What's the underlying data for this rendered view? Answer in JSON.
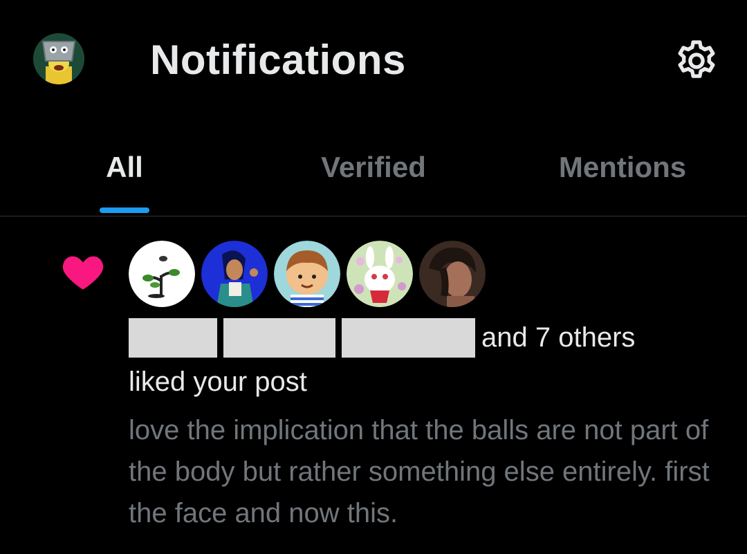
{
  "header": {
    "title": "Notifications",
    "profile_icon": "user-avatar",
    "settings_icon": "gear-icon"
  },
  "tabs": [
    {
      "label": "All",
      "active": true
    },
    {
      "label": "Verified",
      "active": false
    },
    {
      "label": "Mentions",
      "active": false
    }
  ],
  "notification": {
    "type": "like",
    "icon": "heart-icon",
    "icon_color": "#f91880",
    "avatar_count": 5,
    "others_text": "and 7 others",
    "action_text": "liked your post",
    "post_snippet": "love the implication that the balls are not part of the body but rather something else entirely. first the face and now this."
  },
  "colors": {
    "background": "#000000",
    "primary_text": "#e7e9ea",
    "secondary_text": "#71767b",
    "accent": "#1d9bf0",
    "like": "#f91880",
    "redaction": "#d9d9d9"
  }
}
